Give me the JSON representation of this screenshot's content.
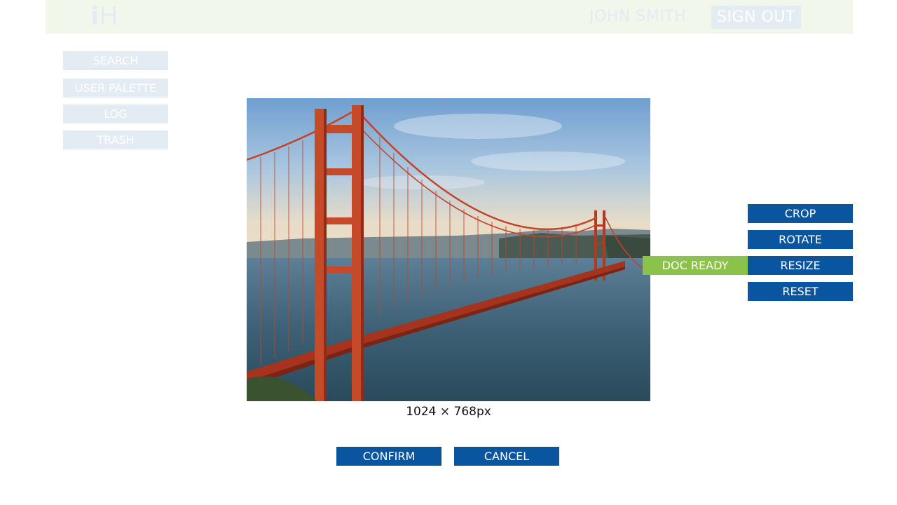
{
  "header": {
    "logo_text_i": "i",
    "logo_text_h": "H",
    "username": "JOHN SMITH",
    "signout_label": "SIGN OUT"
  },
  "sidebar": {
    "items": [
      {
        "label": "SEARCH"
      },
      {
        "label": "USER PALETTE"
      },
      {
        "label": "LOG"
      },
      {
        "label": "TRASH"
      }
    ]
  },
  "image": {
    "dimensions_label": "1024 × 768px"
  },
  "tools": {
    "items": [
      {
        "label": "CROP"
      },
      {
        "label": "ROTATE"
      },
      {
        "label": "RESIZE"
      },
      {
        "label": "RESET"
      }
    ],
    "status_label": "DOC READY"
  },
  "actions": {
    "confirm_label": "CONFIRM",
    "cancel_label": "CANCEL"
  },
  "colors": {
    "primary": "#0a55a0",
    "status_ready": "#8bc34a",
    "muted": "#e3ebf3",
    "topbar_bg": "#f2f7ec"
  }
}
